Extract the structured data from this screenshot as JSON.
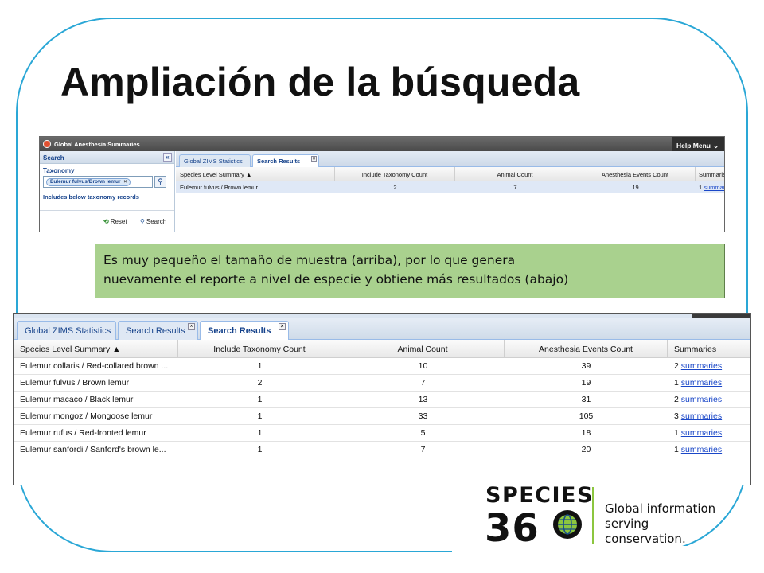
{
  "slide": {
    "title": "Ampliación de la búsqueda"
  },
  "small_screenshot": {
    "app_title": "Global Anesthesia Summaries",
    "help_menu": "Help Menu",
    "search_panel": {
      "title": "Search",
      "taxonomy_label": "Taxonomy",
      "taxonomy_chip": "Eulemur fulvus/Brown lemur",
      "includes_below": "Includes below taxonomy records",
      "reset_label": "Reset",
      "search_label": "Search"
    },
    "tabs": [
      {
        "label": "Global ZIMS Statistics",
        "active": false
      },
      {
        "label": "Search Results",
        "active": true
      }
    ],
    "columns": [
      "Species Level Summary ▲",
      "Include Taxonomy Count",
      "Animal Count",
      "Anesthesia Events Count",
      "Summaries"
    ],
    "rows": [
      {
        "species": "Eulemur fulvus / Brown lemur",
        "taxonomy_count": "2",
        "animal_count": "7",
        "events_count": "19",
        "summaries_count": "1",
        "summaries_link": "summaries"
      }
    ]
  },
  "callout": {
    "line1": "Es muy pequeño el tamaño de muestra (arriba), por lo que genera",
    "line2": "nuevamente el reporte a nivel de especie y obtiene más resultados (abajo)"
  },
  "large_screenshot": {
    "tabs": [
      {
        "label": "Global ZIMS Statistics",
        "active": false
      },
      {
        "label": "Search Results",
        "active": false
      },
      {
        "label": "Search Results",
        "active": true
      }
    ],
    "columns": [
      "Species Level Summary ▲",
      "Include Taxonomy Count",
      "Animal Count",
      "Anesthesia Events Count",
      "Summaries"
    ],
    "rows": [
      {
        "species": "Eulemur collaris / Red-collared brown ...",
        "taxonomy_count": "1",
        "animal_count": "10",
        "events_count": "39",
        "summaries_count": "2",
        "summaries_link": "summaries"
      },
      {
        "species": "Eulemur fulvus / Brown lemur",
        "taxonomy_count": "2",
        "animal_count": "7",
        "events_count": "19",
        "summaries_count": "1",
        "summaries_link": "summaries"
      },
      {
        "species": "Eulemur macaco / Black lemur",
        "taxonomy_count": "1",
        "animal_count": "13",
        "events_count": "31",
        "summaries_count": "2",
        "summaries_link": "summaries"
      },
      {
        "species": "Eulemur mongoz / Mongoose lemur",
        "taxonomy_count": "1",
        "animal_count": "33",
        "events_count": "105",
        "summaries_count": "3",
        "summaries_link": "summaries"
      },
      {
        "species": "Eulemur rufus / Red-fronted lemur",
        "taxonomy_count": "1",
        "animal_count": "5",
        "events_count": "18",
        "summaries_count": "1",
        "summaries_link": "summaries"
      },
      {
        "species": "Eulemur sanfordi / Sanford's brown le...",
        "taxonomy_count": "1",
        "animal_count": "7",
        "events_count": "20",
        "summaries_count": "1",
        "summaries_link": "summaries"
      }
    ]
  },
  "logo": {
    "word": "SPECIES",
    "number": "36",
    "tagline_1": "Global information",
    "tagline_2": "serving conservation."
  },
  "colors": {
    "frame": "#2aa7d6",
    "callout_bg": "#a9d18e",
    "link": "#1a47c8",
    "logo_divider": "#8cc63f"
  },
  "icons": [
    "close-icon",
    "collapse-icon",
    "magnifier-icon",
    "reset-icon",
    "chevron-down-icon",
    "globe-icon"
  ]
}
